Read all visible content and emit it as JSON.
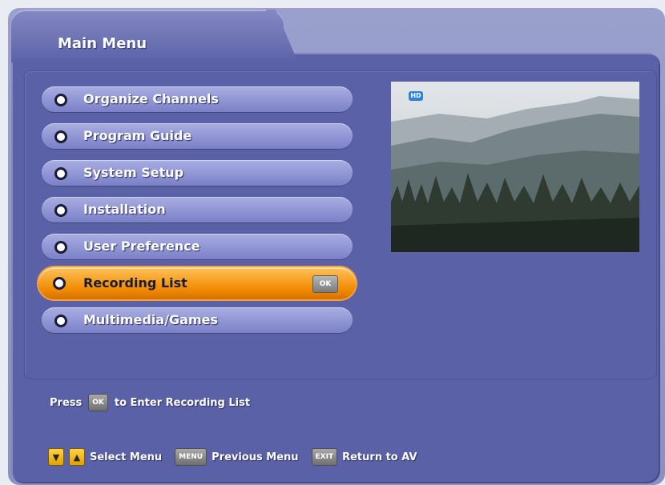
{
  "header": {
    "title": "Main Menu"
  },
  "menu": {
    "items": [
      {
        "label": "Organize Channels",
        "selected": false
      },
      {
        "label": "Program Guide",
        "selected": false
      },
      {
        "label": "System Setup",
        "selected": false
      },
      {
        "label": "Installation",
        "selected": false
      },
      {
        "label": "User Preference",
        "selected": false
      },
      {
        "label": "Recording List",
        "selected": true,
        "badge": "OK"
      },
      {
        "label": "Multimedia/Games",
        "selected": false
      }
    ]
  },
  "preview": {
    "hd_badge": "HD"
  },
  "help": {
    "prefix": "Press",
    "key": "OK",
    "suffix": "to Enter Recording List"
  },
  "footer": {
    "select_label": "Select Menu",
    "menu_key": "MENU",
    "previous_label": "Previous Menu",
    "exit_key": "EXIT",
    "return_label": "Return to AV"
  },
  "colors": {
    "panel": "#5b61a7",
    "menu_item": "#8d92d3",
    "selected_item": "#f08a00",
    "text": "#ffffff"
  }
}
